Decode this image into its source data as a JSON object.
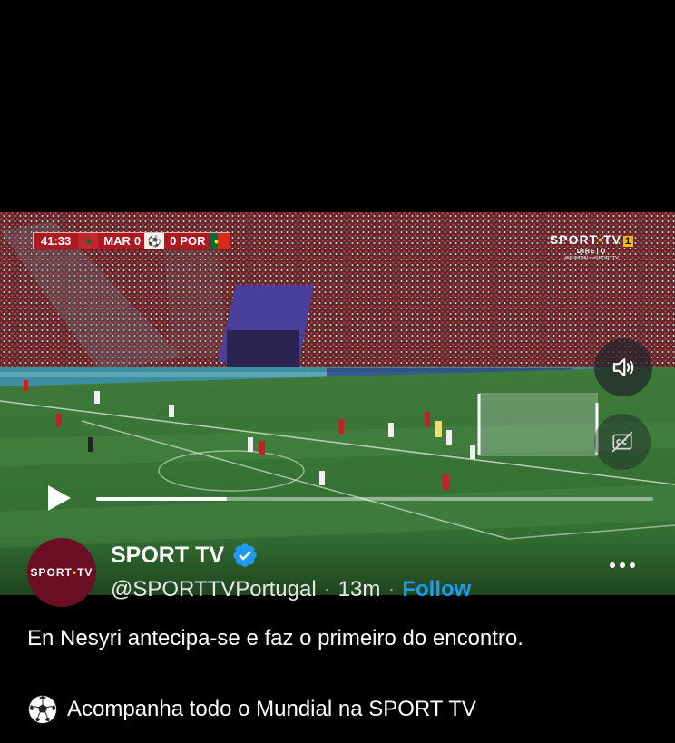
{
  "video": {
    "scoreboard": {
      "clock": "41:33",
      "home_team": "MAR",
      "home_score": "0",
      "away_score": "0",
      "away_team": "POR"
    },
    "broadcaster_logo": {
      "brand": "SPORT",
      "dot": "•",
      "brand_tail": "TV",
      "channel": "1",
      "live": "DIRETO",
      "hashtag": "#MUNDIALnaSPORTTV"
    },
    "progress_fraction": 0.235,
    "icons": {
      "mute": "speaker-icon",
      "captions": "closed-captions-icon",
      "play": "play-icon"
    }
  },
  "tweet": {
    "avatar_text_left": "SPORT",
    "avatar_dot": "•",
    "avatar_text_right": "TV",
    "display_name": "SPORT TV",
    "handle": "@SPORTTVPortugal",
    "separator": "·",
    "time": "13m",
    "follow_label": "Follow",
    "text_line_1": "En Nesyri antecipa-se e faz o primeiro do encontro.",
    "text_line_2": "Acompanha todo o Mundial na SPORT TV"
  },
  "colors": {
    "background": "#000000",
    "accent_blue": "#1d9bf0",
    "avatar_bg": "#6b0f24",
    "brand_yellow": "#f2b705"
  }
}
